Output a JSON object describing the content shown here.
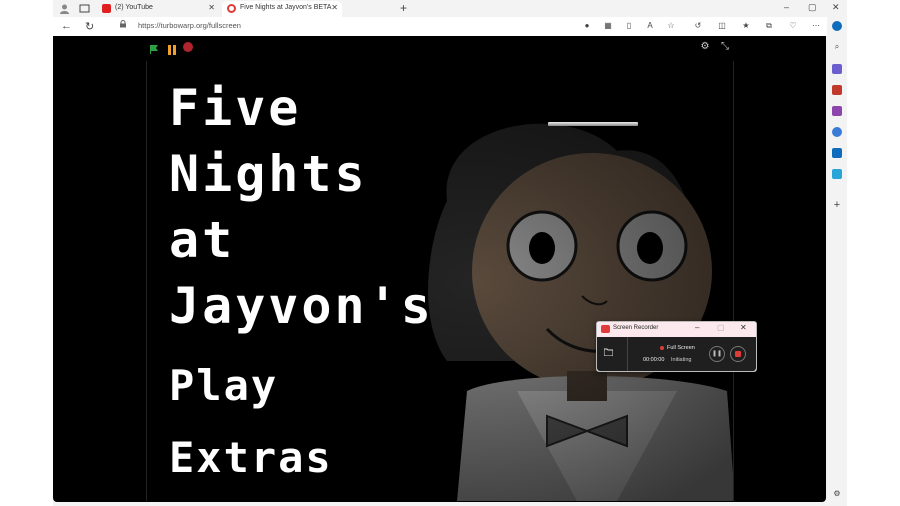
{
  "tabs": [
    {
      "label": "(2) YouTube",
      "fav_color": "#e02020",
      "active": false
    },
    {
      "label": "Five Nights at Jayvon's BETA",
      "fav_color": "#e03b3b",
      "active": true
    }
  ],
  "tab_close_glyph": "✕",
  "new_tab_glyph": "+",
  "window": {
    "minimize": "–",
    "maximize": "▢",
    "close": "✕"
  },
  "address": {
    "url": "https://turbowarp.org/fullscreen"
  },
  "game": {
    "title": "Five\nNights\nat\nJayvon's",
    "menu": [
      "Play",
      "Extras"
    ]
  },
  "recorder": {
    "title": "Screen Recorder",
    "mode": "Full Screen",
    "time": "00:00:00",
    "status": "Initiating"
  },
  "colors": {
    "accent": "#0f6cbd",
    "record_red": "#e03b3b",
    "flag_green": "#2ea043",
    "pause_orange": "#f0a030"
  }
}
